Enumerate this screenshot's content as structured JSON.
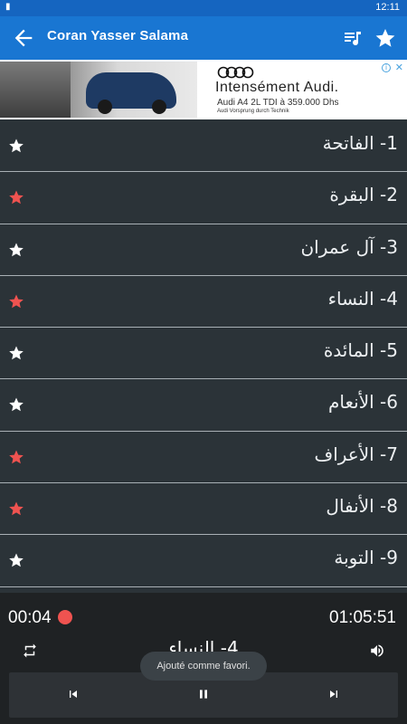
{
  "status_bar": {
    "time": "12:11"
  },
  "app_bar": {
    "title": "Coran Yasser Salama",
    "icons": {
      "back": "arrow-back-icon",
      "playlist": "playlist-icon",
      "favorite": "star-icon"
    }
  },
  "ad": {
    "brand": "Audi",
    "headline": "Intensément Audi.",
    "subline": "Audi A4 2L TDI à 359.000 Dhs",
    "tagline": "Audi Vorsprung durch Technik"
  },
  "surahs": [
    {
      "label": "1- الفاتحة",
      "favorite": false
    },
    {
      "label": "2- البقرة",
      "favorite": true
    },
    {
      "label": "3- آل عمران",
      "favorite": false
    },
    {
      "label": "4- النساء",
      "favorite": true
    },
    {
      "label": "5- المائدة",
      "favorite": false
    },
    {
      "label": "6- الأنعام",
      "favorite": false
    },
    {
      "label": "7- الأعراف",
      "favorite": true
    },
    {
      "label": "8- الأنفال",
      "favorite": true
    },
    {
      "label": "9- التوبة",
      "favorite": false
    }
  ],
  "colors": {
    "favorite_star": "#ef5350",
    "normal_star": "#ffffff",
    "app_bar": "#1976d2"
  },
  "player": {
    "current_time": "00:04",
    "total_time": "01:05:51",
    "now_playing": "4- النساء"
  },
  "toast": {
    "message": "Ajouté comme favori."
  }
}
